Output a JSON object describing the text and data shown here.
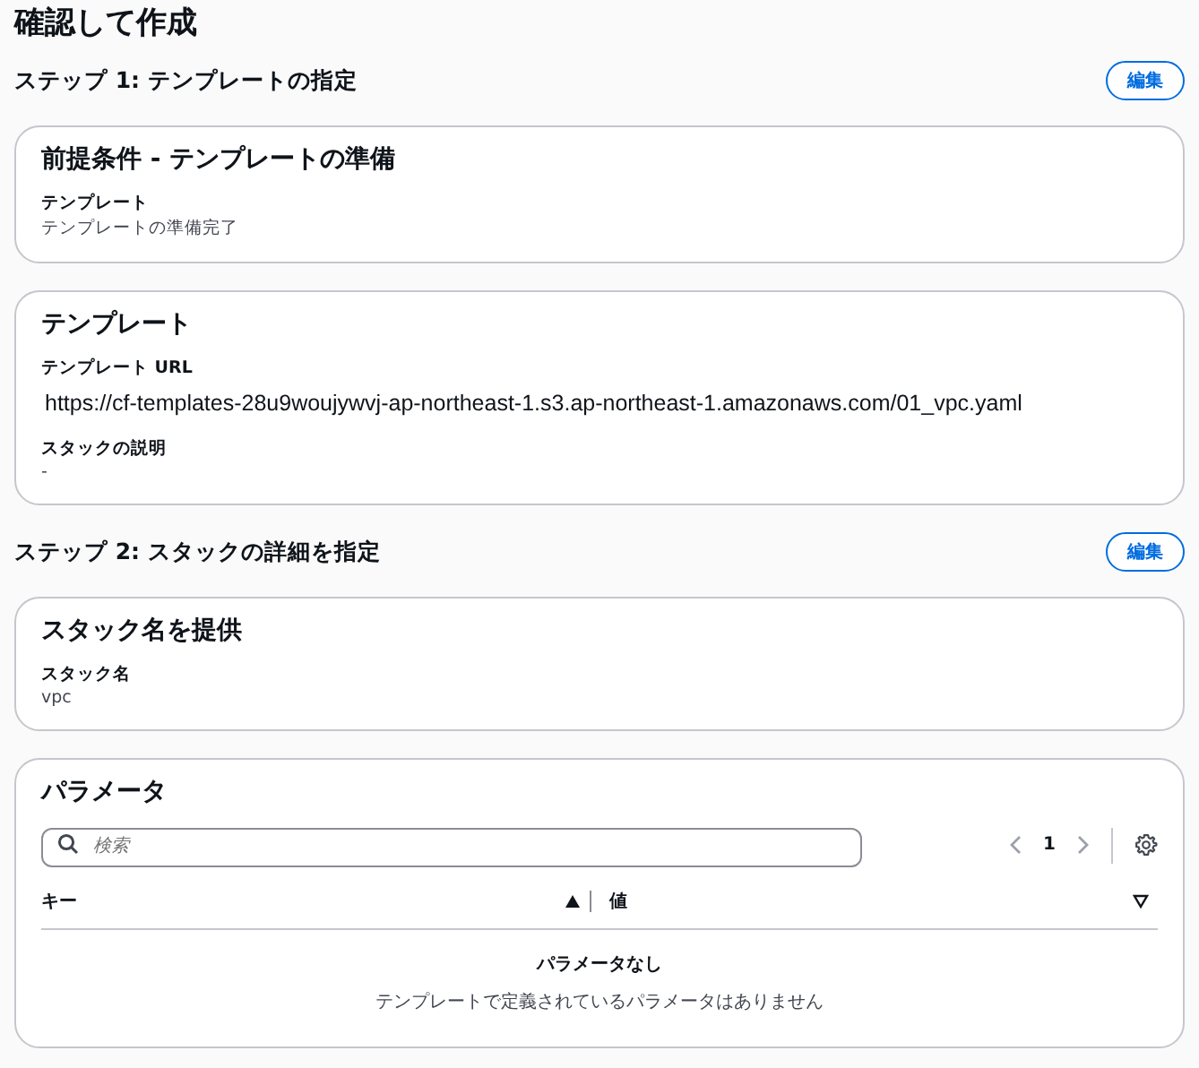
{
  "title": "確認して作成",
  "steps": [
    {
      "title": "ステップ 1: テンプレートの指定",
      "edit_label": "編集",
      "cards": [
        {
          "kind": "fields",
          "title": "前提条件 - テンプレートの準備",
          "fields": [
            {
              "label": "テンプレート",
              "value": "テンプレートの準備完了",
              "kind": "text"
            }
          ]
        },
        {
          "kind": "fields",
          "title": "テンプレート",
          "fields": [
            {
              "label": "テンプレート URL",
              "value": "https://cf-templates-28u9woujywvj-ap-northeast-1.s3.ap-northeast-1.amazonaws.com/01_vpc.yaml",
              "kind": "url"
            },
            {
              "label": "スタックの説明",
              "value": "-",
              "kind": "text"
            }
          ]
        }
      ]
    },
    {
      "title": "ステップ 2: スタックの詳細を指定",
      "edit_label": "編集",
      "cards": [
        {
          "kind": "fields",
          "title": "スタック名を提供",
          "fields": [
            {
              "label": "スタック名",
              "value": "vpc",
              "kind": "text"
            }
          ]
        },
        {
          "kind": "table",
          "title": "パラメータ",
          "search": {
            "placeholder": "検索"
          },
          "page": "1",
          "columns": [
            {
              "label": "キー",
              "sorted": true
            },
            {
              "label": "値",
              "sorted": false
            }
          ],
          "empty_title": "パラメータなし",
          "empty_text": "テンプレートで定義されているパラメータはありません"
        }
      ]
    }
  ]
}
